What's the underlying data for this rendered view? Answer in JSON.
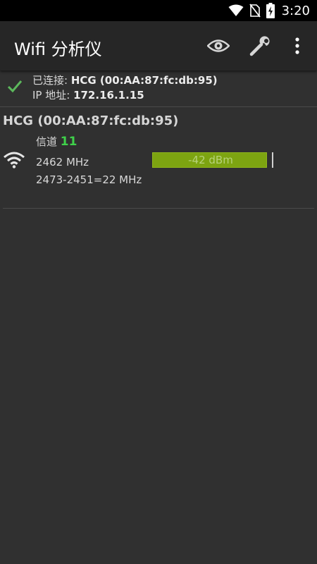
{
  "status_bar": {
    "time": "3:20",
    "icons": [
      "wifi-icon",
      "no-sim-icon",
      "battery-charging-icon"
    ]
  },
  "app_bar": {
    "title": "Wifi 分析仪",
    "actions": [
      "eye-icon",
      "wrench-icon",
      "more-vert-icon"
    ]
  },
  "connection": {
    "connected_label": "已连接: ",
    "connected_value": "HCG (00:AA:87:fc:db:95)",
    "ip_label": "IP 地址: ",
    "ip_value": "172.16.1.15",
    "icon": "check-icon",
    "icon_color": "#5cb85c"
  },
  "networks": [
    {
      "title": "HCG (00:AA:87:fc:db:95)",
      "channel_label": "信道 ",
      "channel": "11",
      "frequency": "2462 MHz",
      "range": "2473-2451=22 MHz",
      "signal_text": "-42 dBm",
      "signal_level": 0.96,
      "signal_color": "#7da411",
      "channel_color": "#3fd14a",
      "icon": "wifi-signal-icon"
    }
  ]
}
